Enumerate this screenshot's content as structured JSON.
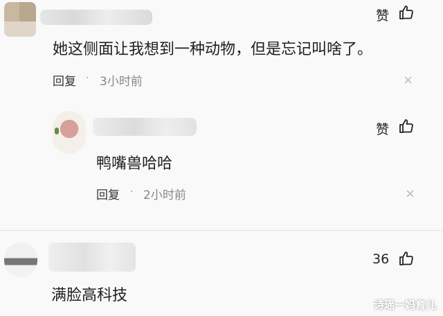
{
  "comments": [
    {
      "text": "她这侧面让我想到一种动物，但是忘记叫啥了。",
      "reply_label": "回复",
      "dot": "·",
      "time": "3小时前",
      "like_label": "赞"
    },
    {
      "text": "鸭嘴兽哈哈",
      "reply_label": "回复",
      "dot": "·",
      "time": "2小时前",
      "like_label": "赞"
    },
    {
      "text": "满脸高科技",
      "like_label": "36"
    }
  ],
  "close_symbol": "×",
  "watermark": "诗瑶一妈育儿",
  "icons": {
    "like": "thumbs-up-icon",
    "close": "close-icon"
  }
}
